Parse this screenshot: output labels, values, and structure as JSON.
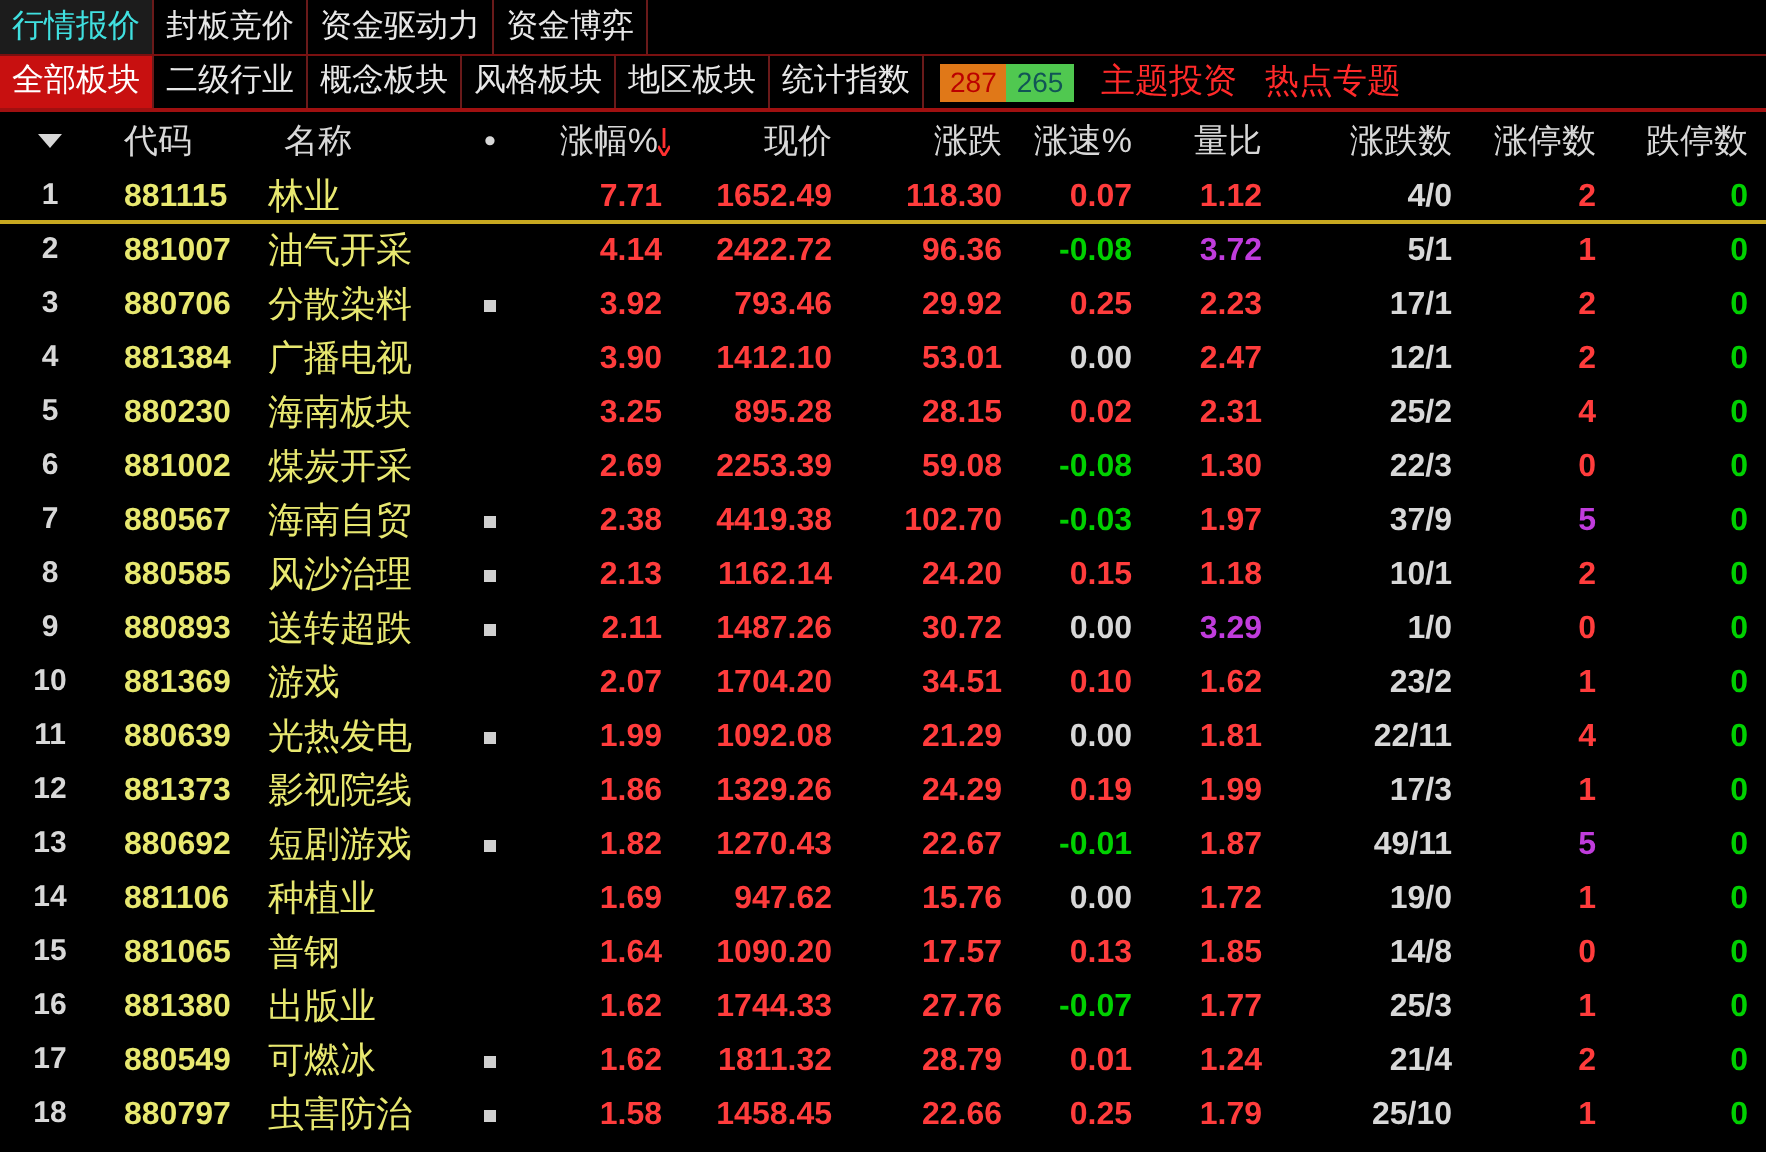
{
  "top_tabs": [
    {
      "label": "行情报价",
      "selected": true
    },
    {
      "label": "封板竞价",
      "selected": false
    },
    {
      "label": "资金驱动力",
      "selected": false
    },
    {
      "label": "资金博弈",
      "selected": false
    }
  ],
  "sector_tabs": [
    {
      "label": "全部板块",
      "selected": true
    },
    {
      "label": "二级行业",
      "selected": false
    },
    {
      "label": "概念板块",
      "selected": false
    },
    {
      "label": "风格板块",
      "selected": false
    },
    {
      "label": "地区板块",
      "selected": false
    },
    {
      "label": "统计指数",
      "selected": false
    }
  ],
  "breadth": {
    "up": "287",
    "down": "265"
  },
  "topic_links": [
    "主题投资",
    "热点专题"
  ],
  "columns": [
    {
      "label": "代码",
      "sorted": false
    },
    {
      "label": "名称",
      "sorted": false
    },
    {
      "label": "•",
      "sorted": false
    },
    {
      "label": "涨幅%",
      "sorted": true
    },
    {
      "label": "现价",
      "sorted": false
    },
    {
      "label": "涨跌",
      "sorted": false
    },
    {
      "label": "涨速%",
      "sorted": false
    },
    {
      "label": "量比",
      "sorted": false
    },
    {
      "label": "涨跌数",
      "sorted": false
    },
    {
      "label": "涨停数",
      "sorted": false
    },
    {
      "label": "跌停数",
      "sorted": false
    }
  ],
  "rows": [
    {
      "no": "1",
      "code": "881115",
      "name": "林业",
      "flag": false,
      "selected": true,
      "cells": [
        {
          "text": "7.71",
          "color": "#ff3c3c"
        },
        {
          "text": "1652.49",
          "color": "#ff3c3c"
        },
        {
          "text": "118.30",
          "color": "#ff3c3c"
        },
        {
          "text": "0.07",
          "color": "#ff3c3c"
        },
        {
          "text": "1.12",
          "color": "#ff3c3c"
        },
        {
          "text": "4/0",
          "color": "#d8d8d8"
        },
        {
          "text": "2",
          "color": "#ff3c3c"
        },
        {
          "text": "0",
          "color": "#00d000"
        }
      ]
    },
    {
      "no": "2",
      "code": "881007",
      "name": "油气开采",
      "flag": false,
      "selected": false,
      "cells": [
        {
          "text": "4.14",
          "color": "#ff3c3c"
        },
        {
          "text": "2422.72",
          "color": "#ff3c3c"
        },
        {
          "text": "96.36",
          "color": "#ff3c3c"
        },
        {
          "text": "-0.08",
          "color": "#00d000"
        },
        {
          "text": "3.72",
          "color": "#c03cdc"
        },
        {
          "text": "5/1",
          "color": "#d8d8d8"
        },
        {
          "text": "1",
          "color": "#ff3c3c"
        },
        {
          "text": "0",
          "color": "#00d000"
        }
      ]
    },
    {
      "no": "3",
      "code": "880706",
      "name": "分散染料",
      "flag": true,
      "selected": false,
      "cells": [
        {
          "text": "3.92",
          "color": "#ff3c3c"
        },
        {
          "text": "793.46",
          "color": "#ff3c3c"
        },
        {
          "text": "29.92",
          "color": "#ff3c3c"
        },
        {
          "text": "0.25",
          "color": "#ff3c3c"
        },
        {
          "text": "2.23",
          "color": "#ff3c3c"
        },
        {
          "text": "17/1",
          "color": "#d8d8d8"
        },
        {
          "text": "2",
          "color": "#ff3c3c"
        },
        {
          "text": "0",
          "color": "#00d000"
        }
      ]
    },
    {
      "no": "4",
      "code": "881384",
      "name": "广播电视",
      "flag": false,
      "selected": false,
      "cells": [
        {
          "text": "3.90",
          "color": "#ff3c3c"
        },
        {
          "text": "1412.10",
          "color": "#ff3c3c"
        },
        {
          "text": "53.01",
          "color": "#ff3c3c"
        },
        {
          "text": "0.00",
          "color": "#d8d8d8"
        },
        {
          "text": "2.47",
          "color": "#ff3c3c"
        },
        {
          "text": "12/1",
          "color": "#d8d8d8"
        },
        {
          "text": "2",
          "color": "#ff3c3c"
        },
        {
          "text": "0",
          "color": "#00d000"
        }
      ]
    },
    {
      "no": "5",
      "code": "880230",
      "name": "海南板块",
      "flag": false,
      "selected": false,
      "cells": [
        {
          "text": "3.25",
          "color": "#ff3c3c"
        },
        {
          "text": "895.28",
          "color": "#ff3c3c"
        },
        {
          "text": "28.15",
          "color": "#ff3c3c"
        },
        {
          "text": "0.02",
          "color": "#ff3c3c"
        },
        {
          "text": "2.31",
          "color": "#ff3c3c"
        },
        {
          "text": "25/2",
          "color": "#d8d8d8"
        },
        {
          "text": "4",
          "color": "#ff3c3c"
        },
        {
          "text": "0",
          "color": "#00d000"
        }
      ]
    },
    {
      "no": "6",
      "code": "881002",
      "name": "煤炭开采",
      "flag": false,
      "selected": false,
      "cells": [
        {
          "text": "2.69",
          "color": "#ff3c3c"
        },
        {
          "text": "2253.39",
          "color": "#ff3c3c"
        },
        {
          "text": "59.08",
          "color": "#ff3c3c"
        },
        {
          "text": "-0.08",
          "color": "#00d000"
        },
        {
          "text": "1.30",
          "color": "#ff3c3c"
        },
        {
          "text": "22/3",
          "color": "#d8d8d8"
        },
        {
          "text": "0",
          "color": "#ff3c3c"
        },
        {
          "text": "0",
          "color": "#00d000"
        }
      ]
    },
    {
      "no": "7",
      "code": "880567",
      "name": "海南自贸",
      "flag": true,
      "selected": false,
      "cells": [
        {
          "text": "2.38",
          "color": "#ff3c3c"
        },
        {
          "text": "4419.38",
          "color": "#ff3c3c"
        },
        {
          "text": "102.70",
          "color": "#ff3c3c"
        },
        {
          "text": "-0.03",
          "color": "#00d000"
        },
        {
          "text": "1.97",
          "color": "#ff3c3c"
        },
        {
          "text": "37/9",
          "color": "#d8d8d8"
        },
        {
          "text": "5",
          "color": "#c03cdc"
        },
        {
          "text": "0",
          "color": "#00d000"
        }
      ]
    },
    {
      "no": "8",
      "code": "880585",
      "name": "风沙治理",
      "flag": true,
      "selected": false,
      "cells": [
        {
          "text": "2.13",
          "color": "#ff3c3c"
        },
        {
          "text": "1162.14",
          "color": "#ff3c3c"
        },
        {
          "text": "24.20",
          "color": "#ff3c3c"
        },
        {
          "text": "0.15",
          "color": "#ff3c3c"
        },
        {
          "text": "1.18",
          "color": "#ff3c3c"
        },
        {
          "text": "10/1",
          "color": "#d8d8d8"
        },
        {
          "text": "2",
          "color": "#ff3c3c"
        },
        {
          "text": "0",
          "color": "#00d000"
        }
      ]
    },
    {
      "no": "9",
      "code": "880893",
      "name": "送转超跌",
      "flag": true,
      "selected": false,
      "cells": [
        {
          "text": "2.11",
          "color": "#ff3c3c"
        },
        {
          "text": "1487.26",
          "color": "#ff3c3c"
        },
        {
          "text": "30.72",
          "color": "#ff3c3c"
        },
        {
          "text": "0.00",
          "color": "#d8d8d8"
        },
        {
          "text": "3.29",
          "color": "#c03cdc"
        },
        {
          "text": "1/0",
          "color": "#d8d8d8"
        },
        {
          "text": "0",
          "color": "#ff3c3c"
        },
        {
          "text": "0",
          "color": "#00d000"
        }
      ]
    },
    {
      "no": "10",
      "code": "881369",
      "name": "游戏",
      "flag": false,
      "selected": false,
      "cells": [
        {
          "text": "2.07",
          "color": "#ff3c3c"
        },
        {
          "text": "1704.20",
          "color": "#ff3c3c"
        },
        {
          "text": "34.51",
          "color": "#ff3c3c"
        },
        {
          "text": "0.10",
          "color": "#ff3c3c"
        },
        {
          "text": "1.62",
          "color": "#ff3c3c"
        },
        {
          "text": "23/2",
          "color": "#d8d8d8"
        },
        {
          "text": "1",
          "color": "#ff3c3c"
        },
        {
          "text": "0",
          "color": "#00d000"
        }
      ]
    },
    {
      "no": "11",
      "code": "880639",
      "name": "光热发电",
      "flag": true,
      "selected": false,
      "cells": [
        {
          "text": "1.99",
          "color": "#ff3c3c"
        },
        {
          "text": "1092.08",
          "color": "#ff3c3c"
        },
        {
          "text": "21.29",
          "color": "#ff3c3c"
        },
        {
          "text": "0.00",
          "color": "#d8d8d8"
        },
        {
          "text": "1.81",
          "color": "#ff3c3c"
        },
        {
          "text": "22/11",
          "color": "#d8d8d8"
        },
        {
          "text": "4",
          "color": "#ff3c3c"
        },
        {
          "text": "0",
          "color": "#00d000"
        }
      ]
    },
    {
      "no": "12",
      "code": "881373",
      "name": "影视院线",
      "flag": false,
      "selected": false,
      "cells": [
        {
          "text": "1.86",
          "color": "#ff3c3c"
        },
        {
          "text": "1329.26",
          "color": "#ff3c3c"
        },
        {
          "text": "24.29",
          "color": "#ff3c3c"
        },
        {
          "text": "0.19",
          "color": "#ff3c3c"
        },
        {
          "text": "1.99",
          "color": "#ff3c3c"
        },
        {
          "text": "17/3",
          "color": "#d8d8d8"
        },
        {
          "text": "1",
          "color": "#ff3c3c"
        },
        {
          "text": "0",
          "color": "#00d000"
        }
      ]
    },
    {
      "no": "13",
      "code": "880692",
      "name": "短剧游戏",
      "flag": true,
      "selected": false,
      "cells": [
        {
          "text": "1.82",
          "color": "#ff3c3c"
        },
        {
          "text": "1270.43",
          "color": "#ff3c3c"
        },
        {
          "text": "22.67",
          "color": "#ff3c3c"
        },
        {
          "text": "-0.01",
          "color": "#00d000"
        },
        {
          "text": "1.87",
          "color": "#ff3c3c"
        },
        {
          "text": "49/11",
          "color": "#d8d8d8"
        },
        {
          "text": "5",
          "color": "#c03cdc"
        },
        {
          "text": "0",
          "color": "#00d000"
        }
      ]
    },
    {
      "no": "14",
      "code": "881106",
      "name": "种植业",
      "flag": false,
      "selected": false,
      "cells": [
        {
          "text": "1.69",
          "color": "#ff3c3c"
        },
        {
          "text": "947.62",
          "color": "#ff3c3c"
        },
        {
          "text": "15.76",
          "color": "#ff3c3c"
        },
        {
          "text": "0.00",
          "color": "#d8d8d8"
        },
        {
          "text": "1.72",
          "color": "#ff3c3c"
        },
        {
          "text": "19/0",
          "color": "#d8d8d8"
        },
        {
          "text": "1",
          "color": "#ff3c3c"
        },
        {
          "text": "0",
          "color": "#00d000"
        }
      ]
    },
    {
      "no": "15",
      "code": "881065",
      "name": "普钢",
      "flag": false,
      "selected": false,
      "cells": [
        {
          "text": "1.64",
          "color": "#ff3c3c"
        },
        {
          "text": "1090.20",
          "color": "#ff3c3c"
        },
        {
          "text": "17.57",
          "color": "#ff3c3c"
        },
        {
          "text": "0.13",
          "color": "#ff3c3c"
        },
        {
          "text": "1.85",
          "color": "#ff3c3c"
        },
        {
          "text": "14/8",
          "color": "#d8d8d8"
        },
        {
          "text": "0",
          "color": "#ff3c3c"
        },
        {
          "text": "0",
          "color": "#00d000"
        }
      ]
    },
    {
      "no": "16",
      "code": "881380",
      "name": "出版业",
      "flag": false,
      "selected": false,
      "cells": [
        {
          "text": "1.62",
          "color": "#ff3c3c"
        },
        {
          "text": "1744.33",
          "color": "#ff3c3c"
        },
        {
          "text": "27.76",
          "color": "#ff3c3c"
        },
        {
          "text": "-0.07",
          "color": "#00d000"
        },
        {
          "text": "1.77",
          "color": "#ff3c3c"
        },
        {
          "text": "25/3",
          "color": "#d8d8d8"
        },
        {
          "text": "1",
          "color": "#ff3c3c"
        },
        {
          "text": "0",
          "color": "#00d000"
        }
      ]
    },
    {
      "no": "17",
      "code": "880549",
      "name": "可燃冰",
      "flag": true,
      "selected": false,
      "cells": [
        {
          "text": "1.62",
          "color": "#ff3c3c"
        },
        {
          "text": "1811.32",
          "color": "#ff3c3c"
        },
        {
          "text": "28.79",
          "color": "#ff3c3c"
        },
        {
          "text": "0.01",
          "color": "#ff3c3c"
        },
        {
          "text": "1.24",
          "color": "#ff3c3c"
        },
        {
          "text": "21/4",
          "color": "#d8d8d8"
        },
        {
          "text": "2",
          "color": "#ff3c3c"
        },
        {
          "text": "0",
          "color": "#00d000"
        }
      ]
    },
    {
      "no": "18",
      "code": "880797",
      "name": "虫害防治",
      "flag": true,
      "selected": false,
      "cells": [
        {
          "text": "1.58",
          "color": "#ff3c3c"
        },
        {
          "text": "1458.45",
          "color": "#ff3c3c"
        },
        {
          "text": "22.66",
          "color": "#ff3c3c"
        },
        {
          "text": "0.25",
          "color": "#ff3c3c"
        },
        {
          "text": "1.79",
          "color": "#ff3c3c"
        },
        {
          "text": "25/10",
          "color": "#d8d8d8"
        },
        {
          "text": "1",
          "color": "#ff3c3c"
        },
        {
          "text": "0",
          "color": "#00d000"
        }
      ]
    }
  ]
}
